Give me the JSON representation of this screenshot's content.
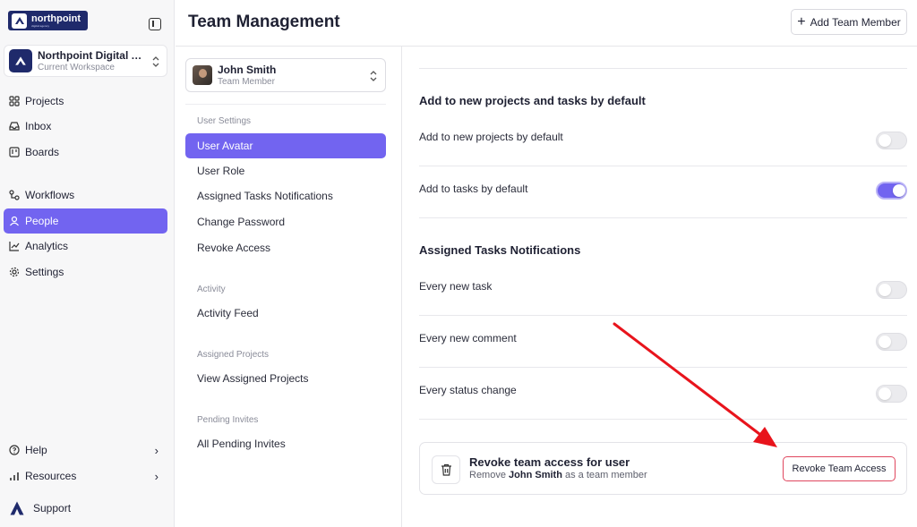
{
  "brand": {
    "logo_text": "northpoint",
    "logo_tagline": "digital agency"
  },
  "workspace": {
    "name": "Northpoint Digital Ag...",
    "label": "Current Workspace"
  },
  "nav": {
    "projects": "Projects",
    "inbox": "Inbox",
    "boards": "Boards",
    "workflows": "Workflows",
    "people": "People",
    "analytics": "Analytics",
    "settings": "Settings",
    "help": "Help",
    "resources": "Resources",
    "support": "Support"
  },
  "header": {
    "title": "Team Management",
    "add_member_label": "Add Team Member"
  },
  "user": {
    "name": "John Smith",
    "role": "Team Member"
  },
  "settings_nav": {
    "user_settings_label": "User Settings",
    "user_settings_items": [
      "User Avatar",
      "User Role",
      "Assigned Tasks Notifications",
      "Change Password",
      "Revoke Access"
    ],
    "activity_label": "Activity",
    "activity_items": [
      "Activity Feed"
    ],
    "assigned_projects_label": "Assigned Projects",
    "assigned_projects_items": [
      "View Assigned Projects"
    ],
    "pending_invites_label": "Pending Invites",
    "pending_invites_items": [
      "All Pending Invites"
    ]
  },
  "main": {
    "defaults": {
      "title": "Add to new projects and tasks by default",
      "rows": [
        {
          "label": "Add to new projects by default",
          "enabled": false
        },
        {
          "label": "Add to tasks by default",
          "enabled": true
        }
      ]
    },
    "notifications": {
      "title": "Assigned Tasks Notifications",
      "rows": [
        {
          "label": "Every new task",
          "enabled": false
        },
        {
          "label": "Every new comment",
          "enabled": false
        },
        {
          "label": "Every status change",
          "enabled": false
        }
      ]
    },
    "revoke": {
      "title": "Revoke team access for user",
      "sub_prefix": "Remove",
      "sub_name": "John Smith",
      "sub_suffix": "as a team member",
      "button_label": "Revoke Team Access"
    }
  },
  "colors": {
    "accent": "#7264f0",
    "brand": "#1f2a6b",
    "danger": "#e0465e",
    "annotation_arrow": "#e8141c"
  }
}
